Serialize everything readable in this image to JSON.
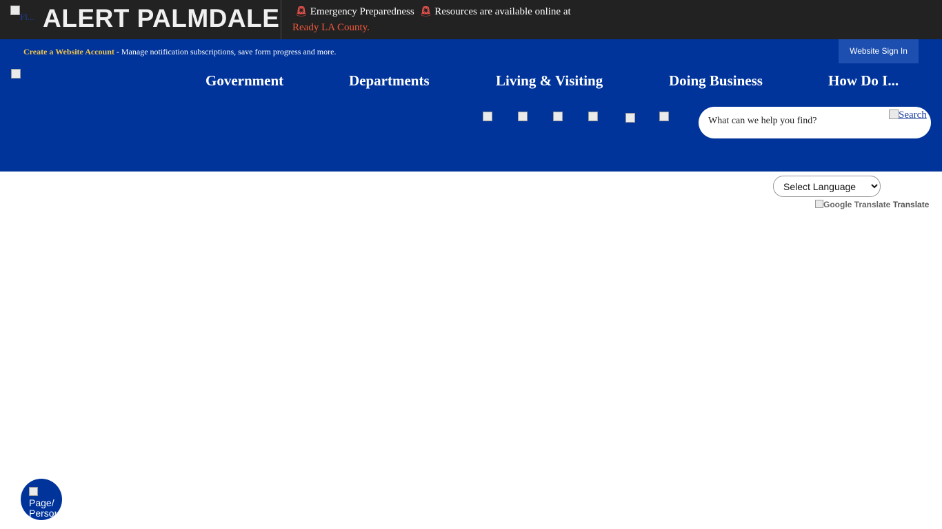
{
  "alert": {
    "logo_alt": "Fl...",
    "title": "ALERT PALMDALE",
    "siren_icon": "siren-icon",
    "message_part1": "Emergency Preparedness",
    "message_part2": "Resources are available online at",
    "message_link": "Ready LA County."
  },
  "account": {
    "create_label": "Create a Website Account",
    "description": " - Manage notification subscriptions, save form progress and more.",
    "signin_label": "Website Sign In"
  },
  "nav": {
    "items": [
      "Government",
      "Departments",
      "Living & Visiting",
      "Doing Business",
      "How Do I..."
    ]
  },
  "quick_links": [
    "quick-link-1-icon",
    "quick-link-2-icon",
    "quick-link-3-icon",
    "quick-link-4-icon",
    "quick-link-5-icon",
    "quick-link-6-icon"
  ],
  "search": {
    "placeholder": "What can we help you find?",
    "button_label": "Search"
  },
  "translate": {
    "select_label": "Select Language",
    "credit_img_alt": "Google Translate",
    "credit_text": "Translate"
  },
  "page_tool": {
    "label": "Page/ Person..."
  },
  "colors": {
    "alert_bg": "#222222",
    "brand_blue": "#00349a",
    "create_link": "#f4c64b",
    "alert_link": "#f2593b"
  }
}
